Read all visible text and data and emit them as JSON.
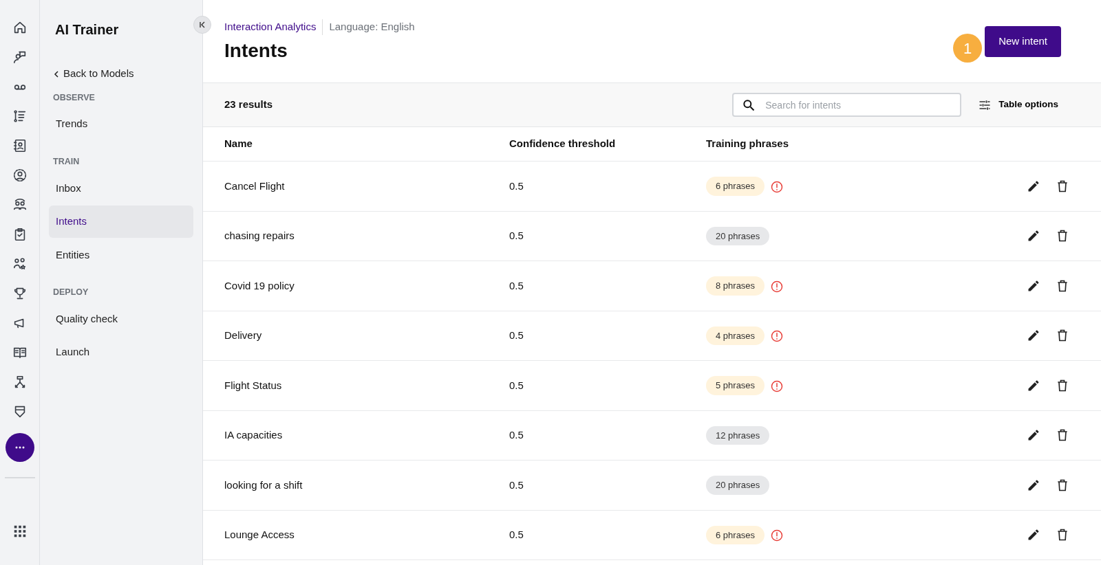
{
  "sidebar": {
    "title": "AI Trainer",
    "back_link": "Back to Models",
    "sections": [
      {
        "heading": "OBSERVE",
        "items": [
          {
            "label": "Trends",
            "selected": false
          }
        ]
      },
      {
        "heading": "TRAIN",
        "items": [
          {
            "label": "Inbox",
            "selected": false
          },
          {
            "label": "Intents",
            "selected": true
          },
          {
            "label": "Entities",
            "selected": false
          }
        ]
      },
      {
        "heading": "DEPLOY",
        "items": [
          {
            "label": "Quality check",
            "selected": false
          },
          {
            "label": "Launch",
            "selected": false
          }
        ]
      }
    ]
  },
  "header": {
    "breadcrumb": "Interaction Analytics",
    "language": "Language: English",
    "title": "Intents",
    "primary_button": "New intent",
    "step_marker": "1"
  },
  "toolbar": {
    "results": "23 results",
    "search": {
      "placeholder": "Search for intents"
    },
    "table_options": "Table options"
  },
  "table": {
    "columns": [
      "Name",
      "Confidence threshold",
      "Training phrases"
    ],
    "rows": [
      {
        "name": "Cancel Flight",
        "threshold": "0.5",
        "phrases": "6 phrases",
        "warning": true
      },
      {
        "name": "chasing repairs",
        "threshold": "0.5",
        "phrases": "20 phrases",
        "warning": false
      },
      {
        "name": "Covid 19 policy",
        "threshold": "0.5",
        "phrases": "8 phrases",
        "warning": true
      },
      {
        "name": "Delivery",
        "threshold": "0.5",
        "phrases": "4 phrases",
        "warning": true
      },
      {
        "name": "Flight Status",
        "threshold": "0.5",
        "phrases": "5 phrases",
        "warning": true
      },
      {
        "name": "IA capacities",
        "threshold": "0.5",
        "phrases": "12 phrases",
        "warning": false
      },
      {
        "name": "looking for a shift",
        "threshold": "0.5",
        "phrases": "20 phrases",
        "warning": false
      },
      {
        "name": "Lounge Access",
        "threshold": "0.5",
        "phrases": "6 phrases",
        "warning": true
      }
    ]
  }
}
